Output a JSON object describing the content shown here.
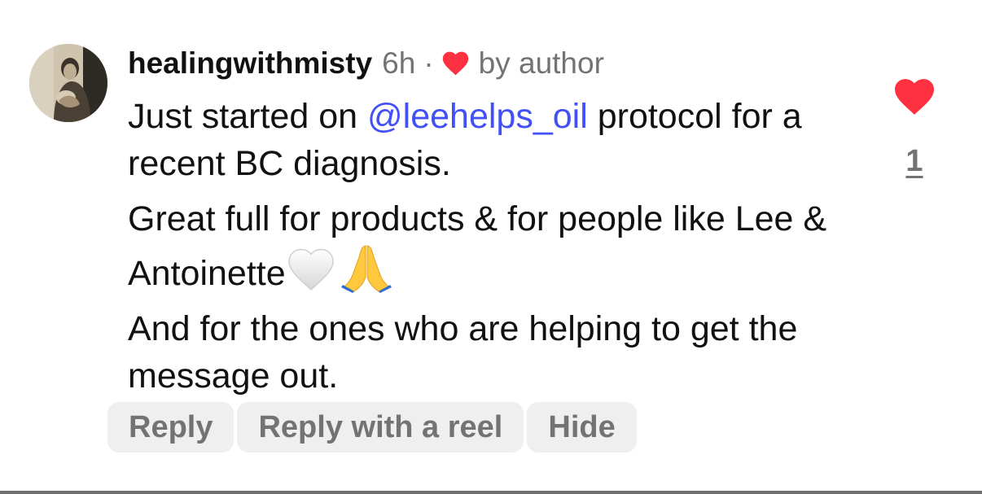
{
  "comment": {
    "username": "healingwithmisty",
    "time": "6h",
    "separator": "·",
    "liked_by_author_label": "by author",
    "avatar_icon": "profile-photo-icon",
    "paragraphs": {
      "p1_before": "Just started on ",
      "p1_mention": "@leehelps_oil",
      "p1_after": " protocol for a recent BC diagnosis.",
      "p2_text": "Great full for products & for people like Lee & Antoinette",
      "p2_emoji_1": "white-heart-icon",
      "p2_emoji_2": "folded-hands-icon",
      "p3_text": "And for the ones who are helping to get the message out."
    },
    "like_count": "1",
    "colors": {
      "heart_red": "#ff3040",
      "mention_blue": "#4150f7",
      "secondary_text": "#737373",
      "button_bg": "#efefef"
    }
  },
  "actions": {
    "reply": "Reply",
    "reply_with_reel": "Reply with a reel",
    "hide": "Hide"
  }
}
